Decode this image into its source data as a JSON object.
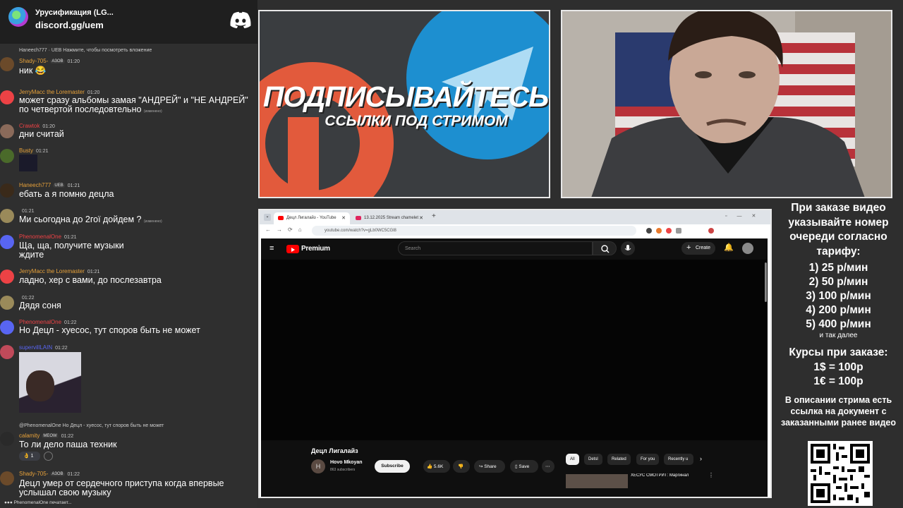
{
  "server": {
    "name": "Урусификация (LG...",
    "link": "discord.gg/uem"
  },
  "chat": [
    {
      "reply": "Haneech777 · UEB  Нажмите, чтобы посмотреть вложение",
      "name": "Shady-705-",
      "badge": "АЗОВ",
      "ts": "01:20",
      "text": "ник 😂",
      "color": "#e8a23a",
      "av": "#6b4a2a"
    },
    {
      "name": "JerryMacc the Loremaster",
      "badge": "",
      "ts": "01:20",
      "text": "может сразу альбомы замая \"АНДРЕЙ\" и \"НЕ АНДРЕЙ\" по четвертой последовтельно",
      "edited": "(изменено)",
      "color": "#e8a23a",
      "av": "#ed4245"
    },
    {
      "name": "Crawtok",
      "badge": "",
      "ts": "01:20",
      "text": "дни считай",
      "color": "#ed4245",
      "av": "#8a6a5a"
    },
    {
      "name": "Busty",
      "badge": "",
      "ts": "01:21",
      "text": "",
      "color": "#e8a23a",
      "av": "#4a6a2a"
    },
    {
      "name": "Haneech777",
      "badge": "UEB",
      "ts": "01:21",
      "text": "ебать а я помню децла",
      "color": "#e8a23a",
      "av": "#3a2a1a"
    },
    {
      "name": "",
      "badge": "",
      "ts": "01:21",
      "text": "Ми сьогодна до 2гої дойдем ?",
      "edited": "(изменено)",
      "color": "#e8a23a",
      "av": "#9a8a5a"
    },
    {
      "name": "PhenomenalOne",
      "badge": "",
      "ts": "01:21",
      "text": "Ща, ща, получите музыки ждите",
      "color": "#ed4245",
      "av": "#5865f2"
    },
    {
      "name": "JerryMacc the Loremaster",
      "badge": "",
      "ts": "01:21",
      "text": "ладно, хер с вами, до послезавтра",
      "color": "#e8a23a",
      "av": "#ed4245"
    },
    {
      "name": "",
      "badge": "",
      "ts": "01:22",
      "text": "Дядя соня",
      "color": "#e8a23a",
      "av": "#9a8a5a"
    },
    {
      "name": "PhenomenalOne",
      "badge": "",
      "ts": "01:22",
      "text": "Но Децл - хуесос, тут споров быть не может",
      "color": "#ed4245",
      "av": "#5865f2"
    },
    {
      "name": "supervillLAIN",
      "badge": "",
      "ts": "01:22",
      "text": "",
      "color": "#5865f2",
      "av": "#c04a5a"
    },
    {
      "reply": "@PhenomenalOne  Но Децл - хуесос, тут споров быть не может",
      "name": "calamity",
      "badge": "MEOW",
      "ts": "01:22",
      "text": "То ли дело паша техник",
      "color": "#e8a23a",
      "av": "#2a2a2a"
    },
    {
      "name": "Shady-705-",
      "badge": "АЗОВ",
      "ts": "01:22",
      "text": "Децл умер от сердечного приступа когда впервые услышал свою музыку",
      "color": "#e8a23a",
      "av": "#6b4a2a"
    }
  ],
  "reaction_count": "1",
  "typing": "PhenomenalOne печатает...",
  "banner": {
    "title": "ПОДПИСЫВАЙТЕСЬ",
    "subtitle": "ССЫЛКИ ПОД СТРИМОМ"
  },
  "browser": {
    "tabs": [
      "Децл Лигалайз - YouTube",
      "13.12.2025 Stream chamelet"
    ],
    "url": "youtube.com/watch?v=gLb0WC5CGl8"
  },
  "youtube": {
    "logo": "Premium",
    "search_placeholder": "Search",
    "create": "Create",
    "video_title": "Децл Лигалайз",
    "channel_initial": "H",
    "channel": "Hovo Mkoyan",
    "subscribers": "863 subscribers",
    "subscribe": "Subscribe",
    "likes": "5.6K",
    "share": "Share",
    "save": "Save",
    "chips": [
      "All",
      "Detsl",
      "Related",
      "For you",
      "Recently u"
    ],
    "rec_title": "ХЕСУС СМОТРИТ: Маргинал"
  },
  "info": {
    "title": "При заказе видео указывайте номер очереди согласно тарифу:",
    "rates": [
      "1) 25 р/мин",
      "2) 50 р/мин",
      "3) 100 р/мин",
      "4) 200 р/мин",
      "5) 400 р/мин"
    ],
    "rates_more": "и так далее",
    "courses_title": "Курсы при заказе:",
    "courses": [
      "1$ = 100р",
      "1€ = 100р"
    ],
    "desc": "В описании стрима есть ссылка на документ с заказанными ранее видео"
  },
  "colors": {
    "discord": "#5865f2",
    "youtube_red": "#ff0000",
    "telegram": "#1d8fd0",
    "patreon": "#e25a3c"
  }
}
